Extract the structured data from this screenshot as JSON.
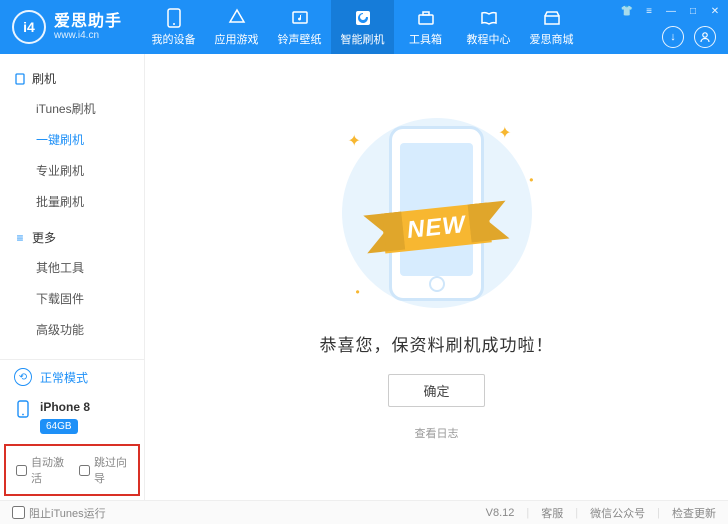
{
  "brand": {
    "logo_text": "i4",
    "title": "爱思助手",
    "url": "www.i4.cn"
  },
  "topnav": [
    {
      "label": "我的设备",
      "name": "nav-device"
    },
    {
      "label": "应用游戏",
      "name": "nav-apps"
    },
    {
      "label": "铃声壁纸",
      "name": "nav-ringtone"
    },
    {
      "label": "智能刷机",
      "name": "nav-flash",
      "active": true
    },
    {
      "label": "工具箱",
      "name": "nav-tools"
    },
    {
      "label": "教程中心",
      "name": "nav-tutorial"
    },
    {
      "label": "爱思商城",
      "name": "nav-store"
    }
  ],
  "sidebar": {
    "groups": [
      {
        "title": "刷机",
        "items": [
          {
            "label": "iTunes刷机"
          },
          {
            "label": "一键刷机",
            "active": true
          },
          {
            "label": "专业刷机"
          },
          {
            "label": "批量刷机"
          }
        ]
      },
      {
        "title": "更多",
        "items": [
          {
            "label": "其他工具"
          },
          {
            "label": "下载固件"
          },
          {
            "label": "高级功能"
          }
        ]
      }
    ],
    "mode": "正常模式",
    "device": {
      "name": "iPhone 8",
      "capacity": "64GB"
    },
    "checks": {
      "auto_activate": "自动激活",
      "skip_setup": "跳过向导"
    }
  },
  "main": {
    "ribbon": "NEW",
    "success": "恭喜您，保资料刷机成功啦！",
    "ok": "确定",
    "view_log": "查看日志"
  },
  "status": {
    "block_itunes": "阻止iTunes运行",
    "version": "V8.12",
    "links": [
      "客服",
      "微信公众号",
      "检查更新"
    ]
  }
}
